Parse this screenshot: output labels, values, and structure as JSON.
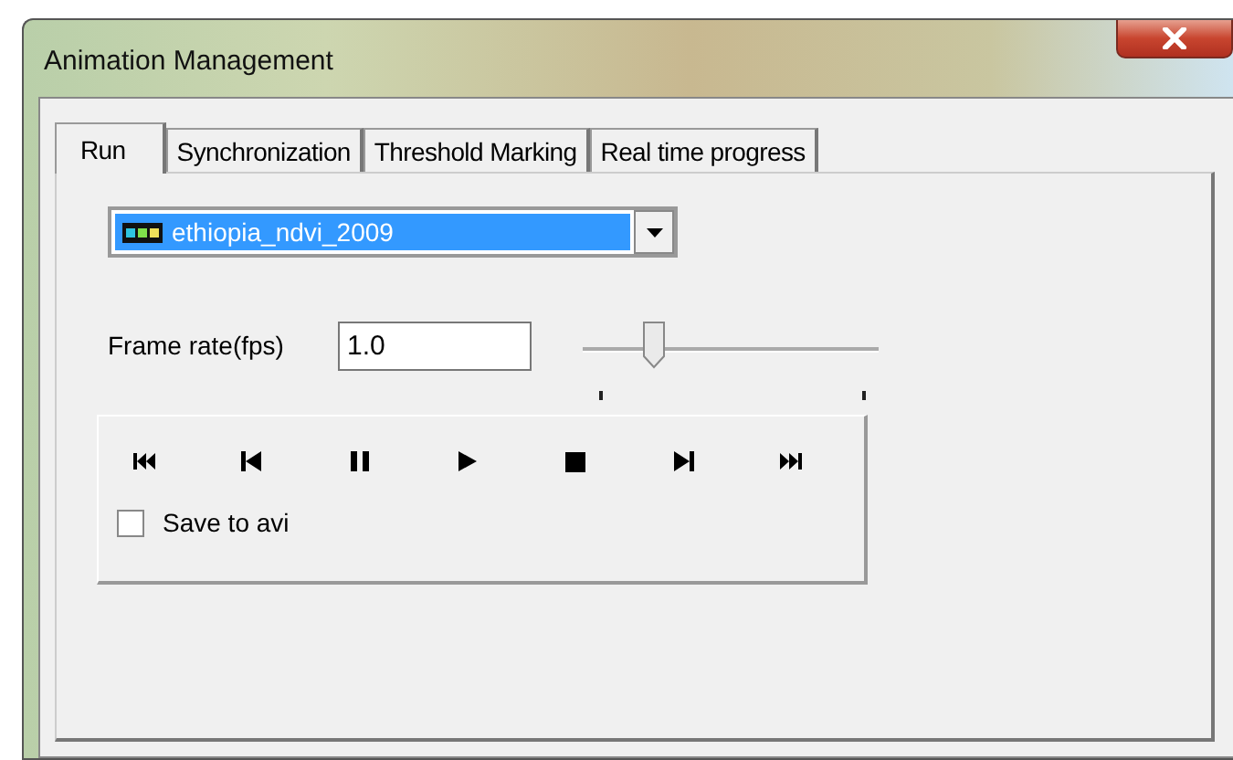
{
  "window": {
    "title": "Animation Management"
  },
  "tabs": [
    {
      "label": "Run",
      "selected": true
    },
    {
      "label": "Synchronization",
      "selected": false
    },
    {
      "label": "Threshold Marking",
      "selected": false
    },
    {
      "label": "Real time progress",
      "selected": false
    }
  ],
  "layer_dropdown": {
    "value": "ethiopia_ndvi_2009"
  },
  "frame_rate": {
    "label": "Frame rate(fps)",
    "value": "1.0"
  },
  "speed_slider": {
    "level": 0.22
  },
  "save_to_avi": {
    "label": "Save to avi",
    "checked": false
  }
}
